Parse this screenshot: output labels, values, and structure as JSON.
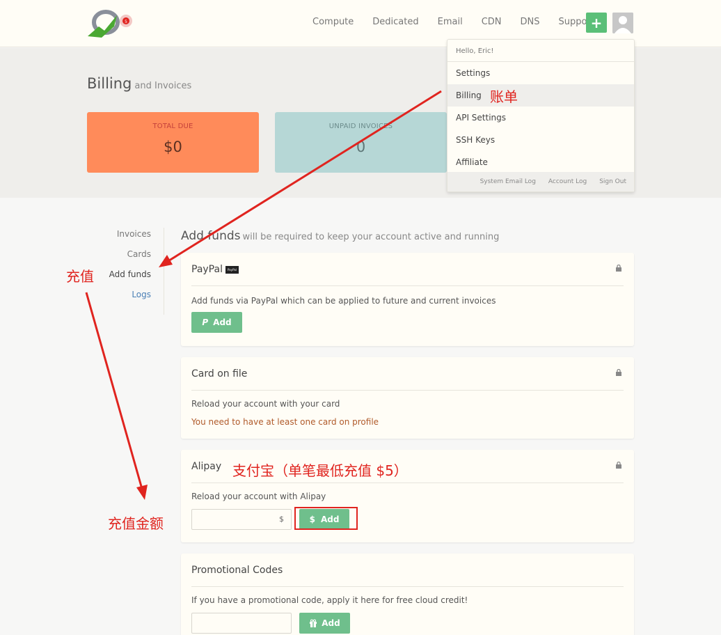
{
  "nav": {
    "items": [
      "Compute",
      "Dedicated",
      "Email",
      "CDN",
      "DNS",
      "Support"
    ],
    "plus_label": "+"
  },
  "header": {
    "title": "Billing",
    "subtitle": "and Invoices"
  },
  "stats": {
    "total_due_label": "TOTAL DUE",
    "total_due_value": "$0",
    "unpaid_label": "UNPAID INVOICES",
    "unpaid_value": "0"
  },
  "dropdown": {
    "greeting": "Hello, Eric!",
    "items": [
      "Settings",
      "Billing",
      "API Settings",
      "SSH Keys",
      "Affiliate"
    ],
    "active": "Billing",
    "footer": [
      "System Email Log",
      "Account Log",
      "Sign Out"
    ]
  },
  "sidenav": {
    "items": [
      "Invoices",
      "Cards",
      "Add funds",
      "Logs"
    ],
    "active": "Add funds"
  },
  "main": {
    "title": "Add funds",
    "subtitle": "will be required to keep your account active and running"
  },
  "cards": {
    "paypal": {
      "title": "PayPal",
      "badge": "PayPal",
      "description": "Add funds via PayPal which can be applied to future and current invoices",
      "button": "Add",
      "button_icon": "P"
    },
    "card_on_file": {
      "title": "Card on file",
      "description": "Reload your account with your card",
      "warning": "You need to have at least one card on profile"
    },
    "alipay": {
      "title": "Alipay",
      "description": "Reload your account with Alipay",
      "currency": "$",
      "button": "Add",
      "button_icon": "$"
    },
    "promo": {
      "title": "Promotional Codes",
      "description": "If you have a promotional code, apply it here for free cloud credit!",
      "button": "Add"
    }
  },
  "annotations": {
    "billing": "账单",
    "add_funds": "充值",
    "alipay": "支付宝（单笔最低充值 $5）",
    "amount": "充值金额"
  },
  "colors": {
    "accent_green": "#6fbf8c",
    "total_due_bg": "#ff8b5a",
    "unpaid_bg": "#b6d7d6",
    "annotation_red": "#e0241f"
  }
}
